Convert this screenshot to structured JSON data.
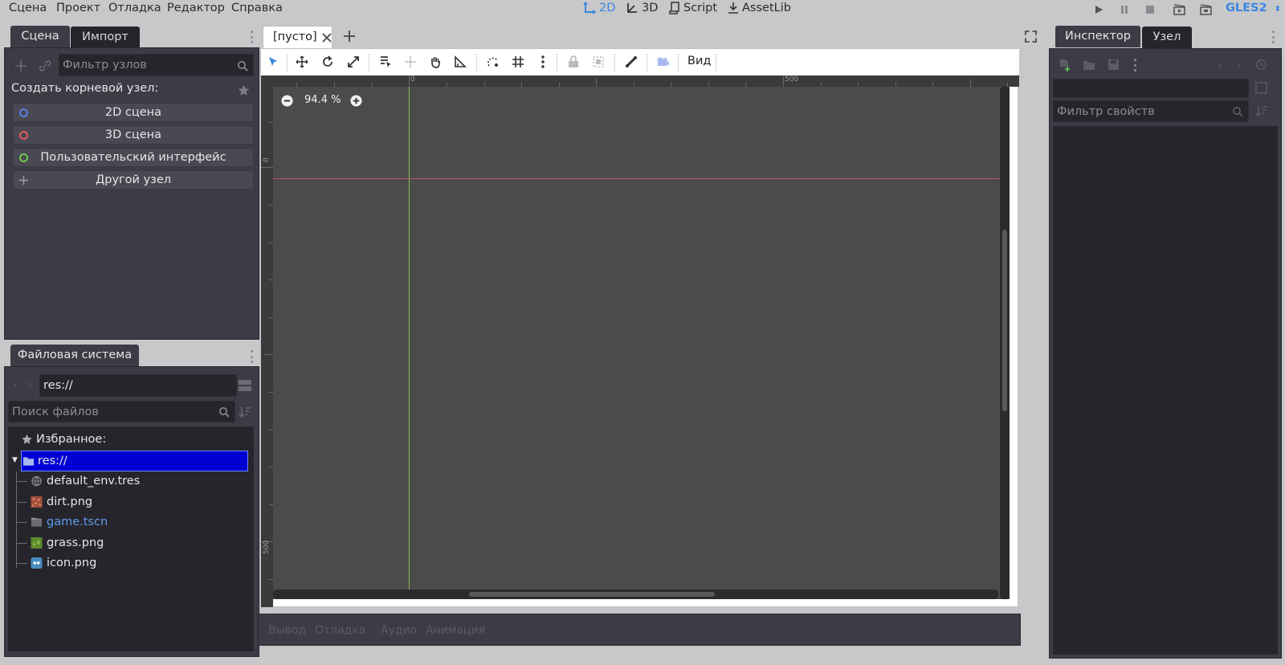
{
  "menubar": {
    "items": [
      "Сцена",
      "Проект",
      "Отладка",
      "Редактор",
      "Справка"
    ],
    "modes": [
      {
        "label": "2D",
        "active": true
      },
      {
        "label": "3D",
        "active": false
      },
      {
        "label": "Script",
        "active": false
      },
      {
        "label": "AssetLib",
        "active": false
      }
    ],
    "renderer": "GLES2"
  },
  "scene_dock": {
    "tabs": [
      "Сцена",
      "Импорт"
    ],
    "filter_placeholder": "Фильтр узлов",
    "create_root_label": "Создать корневой узел:",
    "root_buttons": [
      {
        "label": "2D сцена",
        "color": "#5c7fe8"
      },
      {
        "label": "3D сцена",
        "color": "#e05c5c"
      },
      {
        "label": "Пользовательский интерфейс",
        "color": "#6cc94f"
      },
      {
        "label": "Другой узел",
        "color": "#a0a0a8"
      }
    ]
  },
  "filesystem_dock": {
    "tab": "Файловая система",
    "path": "res://",
    "search_placeholder": "Поиск файлов",
    "favorites_label": "Избранное:",
    "root_label": "res://",
    "files": [
      {
        "name": "default_env.tres",
        "icon": "globe-icon",
        "color": "#e6e6e6"
      },
      {
        "name": "dirt.png",
        "icon": "image-dirt-icon",
        "color": "#e6e6e6"
      },
      {
        "name": "game.tscn",
        "icon": "scene-icon",
        "color": "#5d9cec"
      },
      {
        "name": "grass.png",
        "icon": "image-grass-icon",
        "color": "#e6e6e6"
      },
      {
        "name": "icon.png",
        "icon": "image-icon",
        "color": "#e6e6e6"
      }
    ]
  },
  "editor": {
    "scene_tab": "[пусто]",
    "view_menu": "Вид",
    "zoom": "94.4 %",
    "ruler_labels": {
      "top_zero": "0",
      "top_500": "500",
      "left_zero": "0",
      "left_500": "500"
    }
  },
  "bottom_panel": {
    "tabs": [
      "Вывод",
      "Отладка",
      "Аудио",
      "Анимация"
    ]
  },
  "inspector_dock": {
    "tabs": [
      "Инспектор",
      "Узел"
    ],
    "filter_placeholder": "Фильтр свойств"
  },
  "colors": {
    "accent": "#3a86e0",
    "panel_bg": "#3d3b45",
    "field_bg": "#27252c",
    "selection": "#0000d4",
    "axis_x": "#b8566e",
    "axis_y": "#8dbc4e"
  }
}
